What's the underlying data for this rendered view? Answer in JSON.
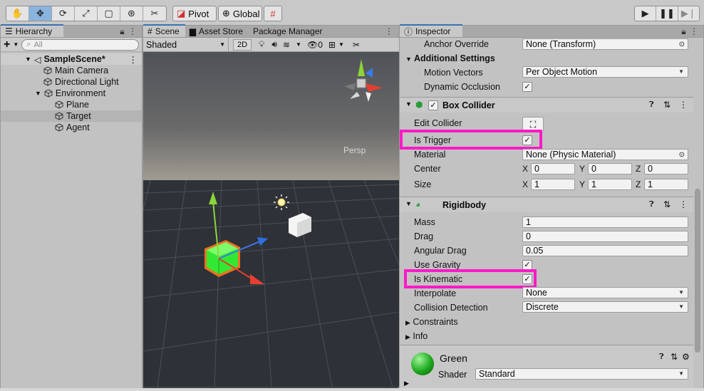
{
  "toolbar": {
    "tools": [
      "hand-icon",
      "move-icon",
      "rotate-icon",
      "scale-icon",
      "rect-icon",
      "transform-icon",
      "custom-tool-icon"
    ],
    "pivot_label": "Pivot",
    "global_label": "Global",
    "play_icons": [
      "play-icon",
      "pause-icon",
      "step-icon"
    ]
  },
  "hierarchy": {
    "tab": "Hierarchy",
    "add_label": "+",
    "search_placeholder": "All",
    "scene_name": "SampleScene*",
    "items": [
      {
        "label": "Main Camera",
        "depth": 1
      },
      {
        "label": "Directional Light",
        "depth": 1
      },
      {
        "label": "Environment",
        "depth": 1
      },
      {
        "label": "Plane",
        "depth": 2
      },
      {
        "label": "Target",
        "depth": 2,
        "selected": true
      },
      {
        "label": "Agent",
        "depth": 2
      }
    ]
  },
  "scene": {
    "tabs": [
      "Scene",
      "Asset Store",
      "Package Manager"
    ],
    "draw_mode": "Shaded",
    "mode_2d": "2D",
    "gizmo_count": "0",
    "persp_label": "Persp"
  },
  "inspector": {
    "tab": "Inspector",
    "anchor_override": {
      "label": "Anchor Override",
      "value": "None (Transform)"
    },
    "additional_settings": "Additional Settings",
    "motion_vectors": {
      "label": "Motion Vectors",
      "value": "Per Object Motion"
    },
    "dynamic_occlusion": {
      "label": "Dynamic Occlusion",
      "checked": true
    },
    "box_collider": {
      "title": "Box Collider",
      "edit_collider": "Edit Collider",
      "is_trigger": "Is Trigger",
      "material_label": "Material",
      "material_value": "None (Physic Material)",
      "center_label": "Center",
      "center": {
        "x": "0",
        "y": "0",
        "z": "0"
      },
      "size_label": "Size",
      "size": {
        "x": "1",
        "y": "1",
        "z": "1"
      }
    },
    "rigidbody": {
      "title": "Rigidbody",
      "mass_label": "Mass",
      "mass": "1",
      "drag_label": "Drag",
      "drag": "0",
      "angular_drag_label": "Angular Drag",
      "angular_drag": "0.05",
      "use_gravity": "Use Gravity",
      "is_kinematic": "Is Kinematic",
      "interpolate_label": "Interpolate",
      "interpolate": "None",
      "collision_label": "Collision Detection",
      "collision": "Discrete",
      "constraints": "Constraints",
      "info": "Info"
    },
    "material": {
      "name": "Green",
      "shader_label": "Shader",
      "shader": "Standard"
    },
    "axis_x": "X",
    "axis_y": "Y",
    "axis_z": "Z"
  },
  "colors": {
    "highlight": "#ff19c8",
    "selected_blue": "#8ab4e0",
    "cube_green": "#28d828"
  }
}
